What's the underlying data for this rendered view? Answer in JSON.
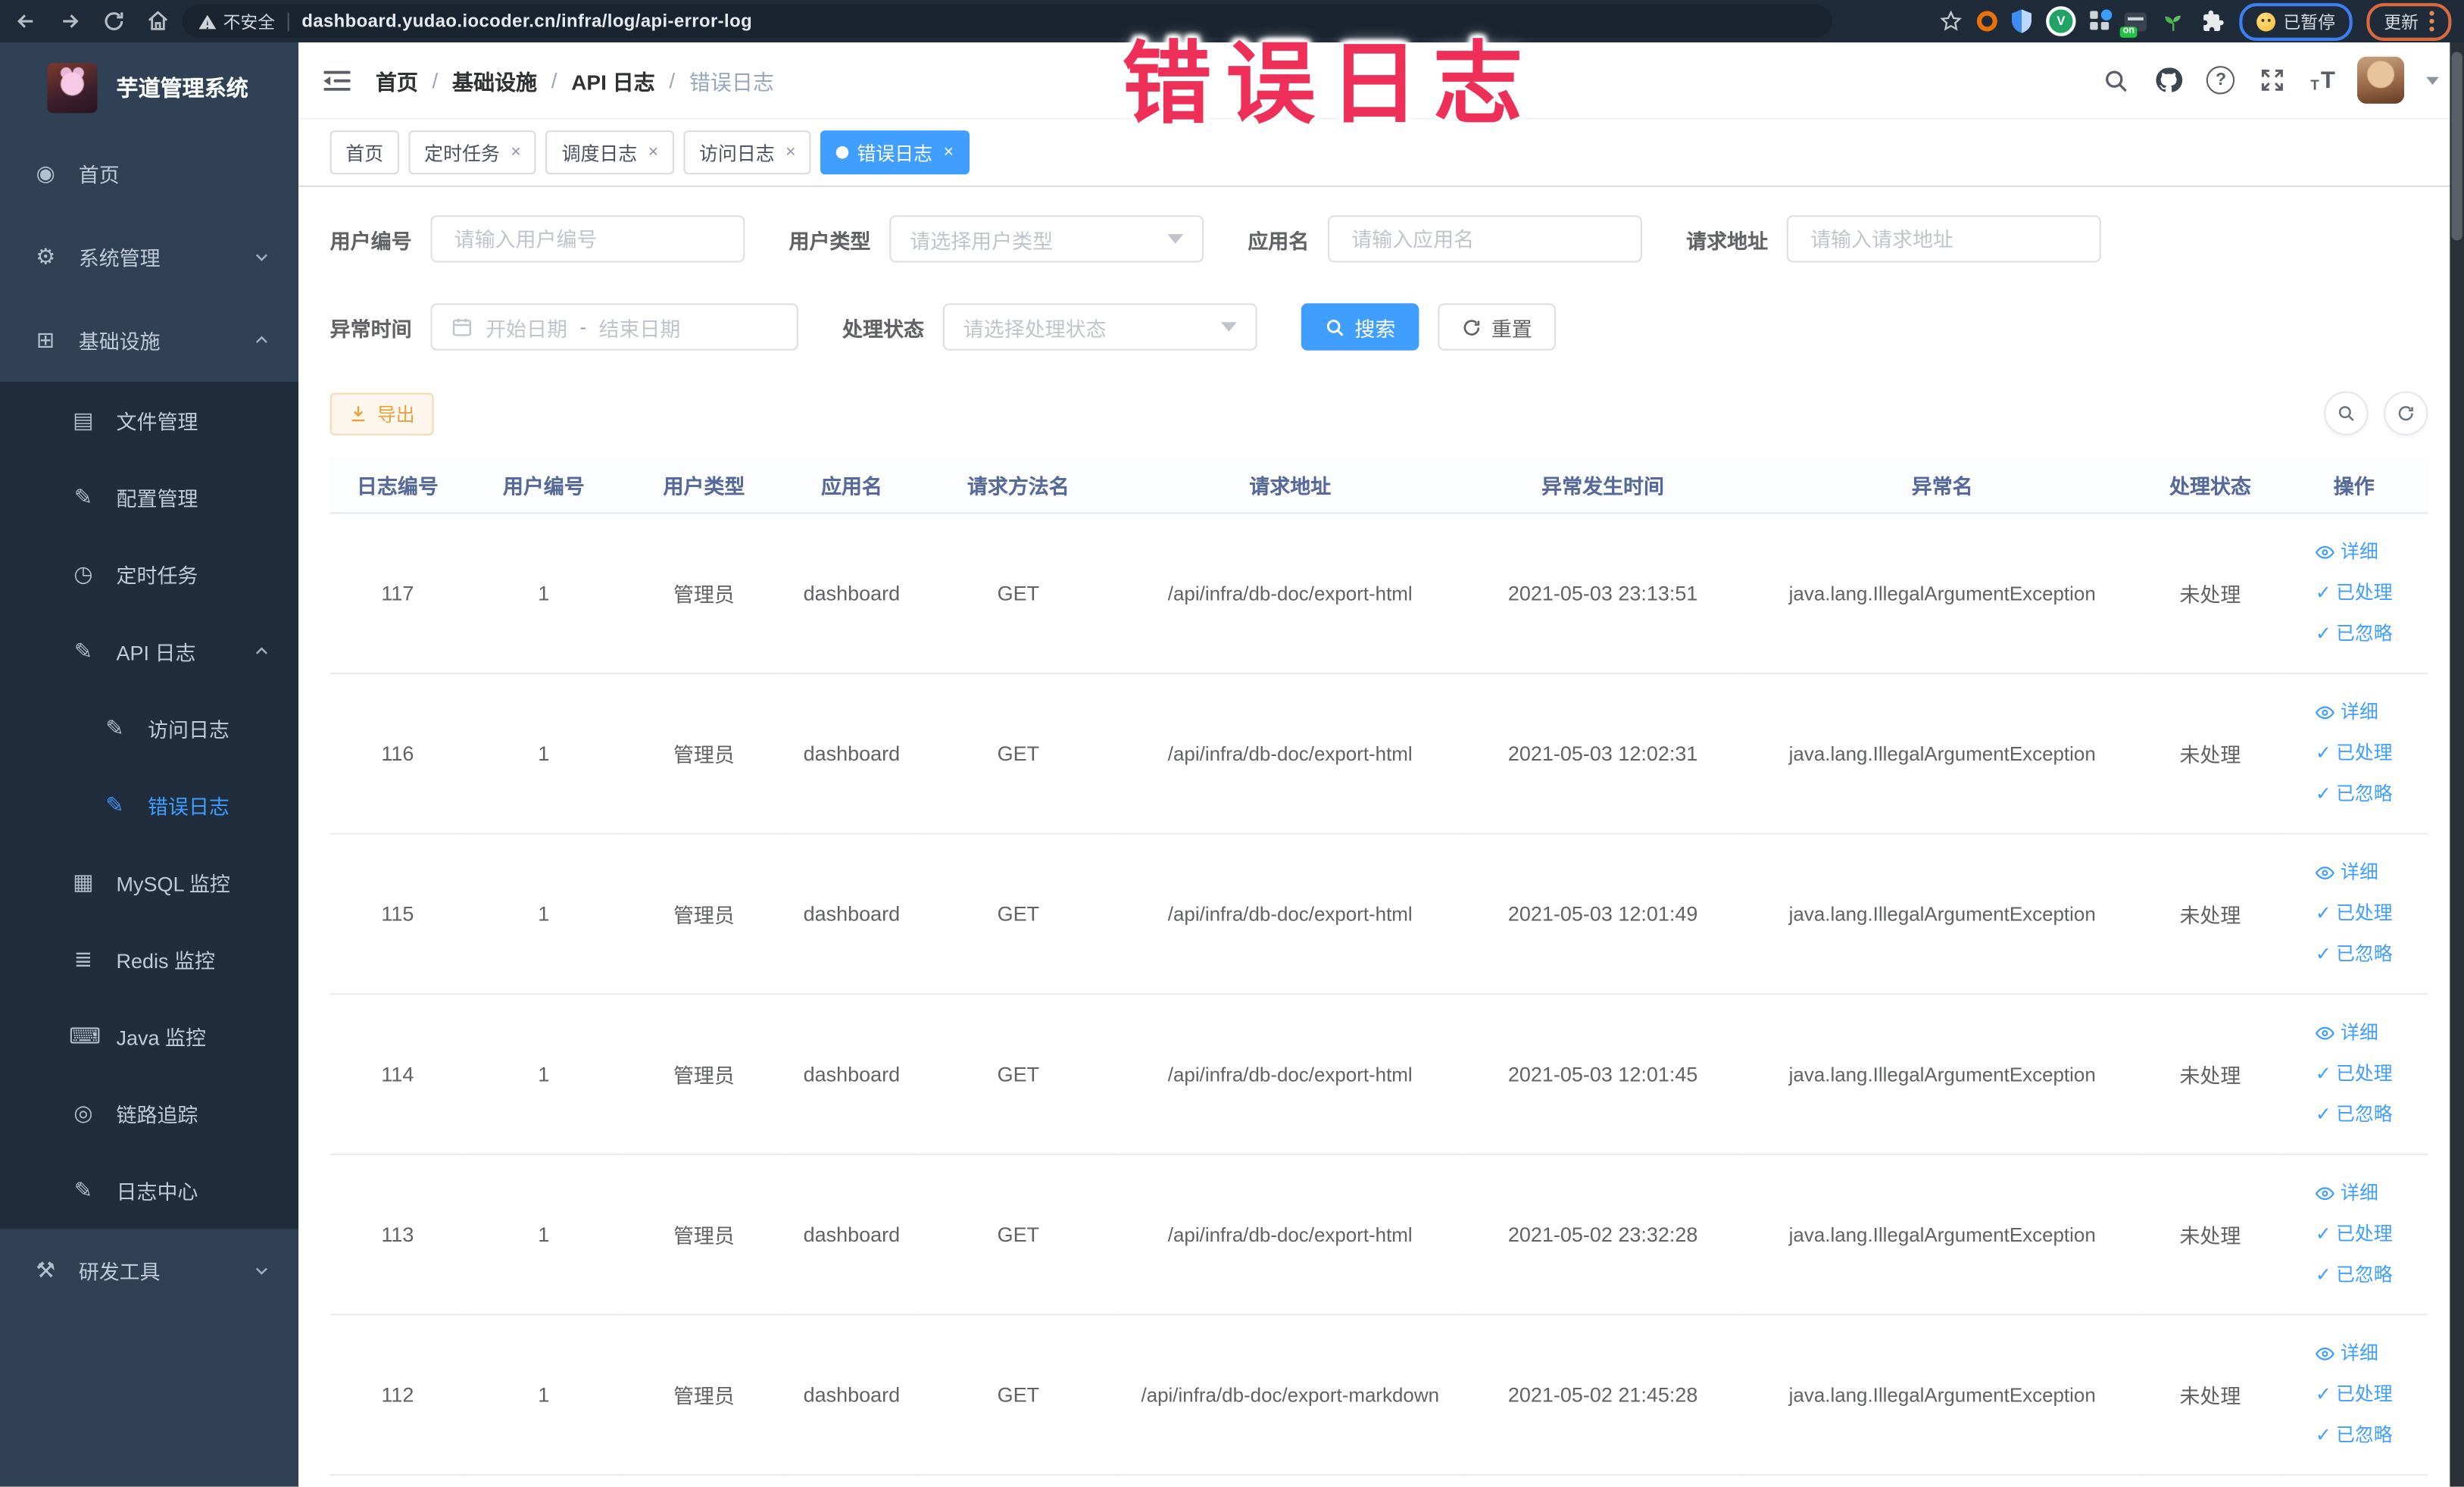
{
  "browser": {
    "security_label": "不安全",
    "url": "dashboard.yudao.iocoder.cn/infra/log/api-error-log",
    "paused_pill_label": "已暂停",
    "update_pill_label": "更新"
  },
  "annotation": {
    "text": "错误日志",
    "color": "#ee3058"
  },
  "sidebar": {
    "logo_title": "芋道管理系统",
    "menu": [
      {
        "label": "首页",
        "icon": "dashboard-icon",
        "level": 1
      },
      {
        "label": "系统管理",
        "icon": "gear-icon",
        "level": 1,
        "chevron": "down"
      },
      {
        "label": "基础设施",
        "icon": "component-icon",
        "level": 1,
        "chevron": "up"
      },
      {
        "label": "文件管理",
        "icon": "files-icon",
        "level": 2
      },
      {
        "label": "配置管理",
        "icon": "edit-icon",
        "level": 2
      },
      {
        "label": "定时任务",
        "icon": "timer-icon",
        "level": 2
      },
      {
        "label": "API 日志",
        "icon": "log-icon",
        "level": 2,
        "chevron": "up"
      },
      {
        "label": "访问日志",
        "icon": "log-icon",
        "level": 3
      },
      {
        "label": "错误日志",
        "icon": "log-icon",
        "level": 3,
        "active": true
      },
      {
        "label": "MySQL 监控",
        "icon": "database-icon",
        "level": 2
      },
      {
        "label": "Redis 监控",
        "icon": "layers-icon",
        "level": 2
      },
      {
        "label": "Java 监控",
        "icon": "java-icon",
        "level": 2
      },
      {
        "label": "链路追踪",
        "icon": "trace-icon",
        "level": 2
      },
      {
        "label": "日志中心",
        "icon": "log-icon",
        "level": 2
      },
      {
        "label": "研发工具",
        "icon": "tools-icon",
        "level": 1,
        "chevron": "down"
      }
    ]
  },
  "header": {
    "breadcrumb": [
      "首页",
      "基础设施",
      "API 日志",
      "错误日志"
    ],
    "separator": "/"
  },
  "tags": [
    {
      "label": "首页",
      "closable": false,
      "active": false
    },
    {
      "label": "定时任务",
      "closable": true,
      "active": false
    },
    {
      "label": "调度日志",
      "closable": true,
      "active": false
    },
    {
      "label": "访问日志",
      "closable": true,
      "active": false
    },
    {
      "label": "错误日志",
      "closable": true,
      "active": true
    }
  ],
  "filters": {
    "user_id": {
      "label": "用户编号",
      "placeholder": "请输入用户编号"
    },
    "user_type": {
      "label": "用户类型",
      "placeholder": "请选择用户类型"
    },
    "app_name": {
      "label": "应用名",
      "placeholder": "请输入应用名"
    },
    "request_url": {
      "label": "请求地址",
      "placeholder": "请输入请求地址"
    },
    "exception_time": {
      "label": "异常时间",
      "start_placeholder": "开始日期",
      "separator": "-",
      "end_placeholder": "结束日期"
    },
    "process_status": {
      "label": "处理状态",
      "placeholder": "请选择处理状态"
    },
    "search_button": "搜索",
    "reset_button": "重置"
  },
  "toolbar": {
    "export_button": "导出"
  },
  "table": {
    "columns": [
      "日志编号",
      "用户编号",
      "用户类型",
      "应用名",
      "请求方法名",
      "请求地址",
      "异常发生时间",
      "异常名",
      "处理状态",
      "操作"
    ],
    "action_labels": {
      "detail": "详细",
      "processed": "已处理",
      "ignored": "已忽略"
    },
    "rows": [
      {
        "id": "117",
        "user_id": "1",
        "user_type": "管理员",
        "app": "dashboard",
        "method": "GET",
        "url": "/api/infra/db-doc/export-html",
        "time": "2021-05-03 23:13:51",
        "exception": "java.lang.IllegalArgumentException",
        "status": "未处理"
      },
      {
        "id": "116",
        "user_id": "1",
        "user_type": "管理员",
        "app": "dashboard",
        "method": "GET",
        "url": "/api/infra/db-doc/export-html",
        "time": "2021-05-03 12:02:31",
        "exception": "java.lang.IllegalArgumentException",
        "status": "未处理"
      },
      {
        "id": "115",
        "user_id": "1",
        "user_type": "管理员",
        "app": "dashboard",
        "method": "GET",
        "url": "/api/infra/db-doc/export-html",
        "time": "2021-05-03 12:01:49",
        "exception": "java.lang.IllegalArgumentException",
        "status": "未处理"
      },
      {
        "id": "114",
        "user_id": "1",
        "user_type": "管理员",
        "app": "dashboard",
        "method": "GET",
        "url": "/api/infra/db-doc/export-html",
        "time": "2021-05-03 12:01:45",
        "exception": "java.lang.IllegalArgumentException",
        "status": "未处理"
      },
      {
        "id": "113",
        "user_id": "1",
        "user_type": "管理员",
        "app": "dashboard",
        "method": "GET",
        "url": "/api/infra/db-doc/export-html",
        "time": "2021-05-02 23:32:28",
        "exception": "java.lang.IllegalArgumentException",
        "status": "未处理"
      },
      {
        "id": "112",
        "user_id": "1",
        "user_type": "管理员",
        "app": "dashboard",
        "method": "GET",
        "url": "/api/infra/db-doc/export-markdown",
        "time": "2021-05-02 21:45:28",
        "exception": "java.lang.IllegalArgumentException",
        "status": "未处理"
      }
    ]
  },
  "colors": {
    "accent": "#409EFF",
    "sidebar_bg": "#304156",
    "submenu_bg": "#1f2d3d",
    "warning": "#e6a23c",
    "annotation": "#ee3058",
    "browser_bar": "#202b39"
  }
}
